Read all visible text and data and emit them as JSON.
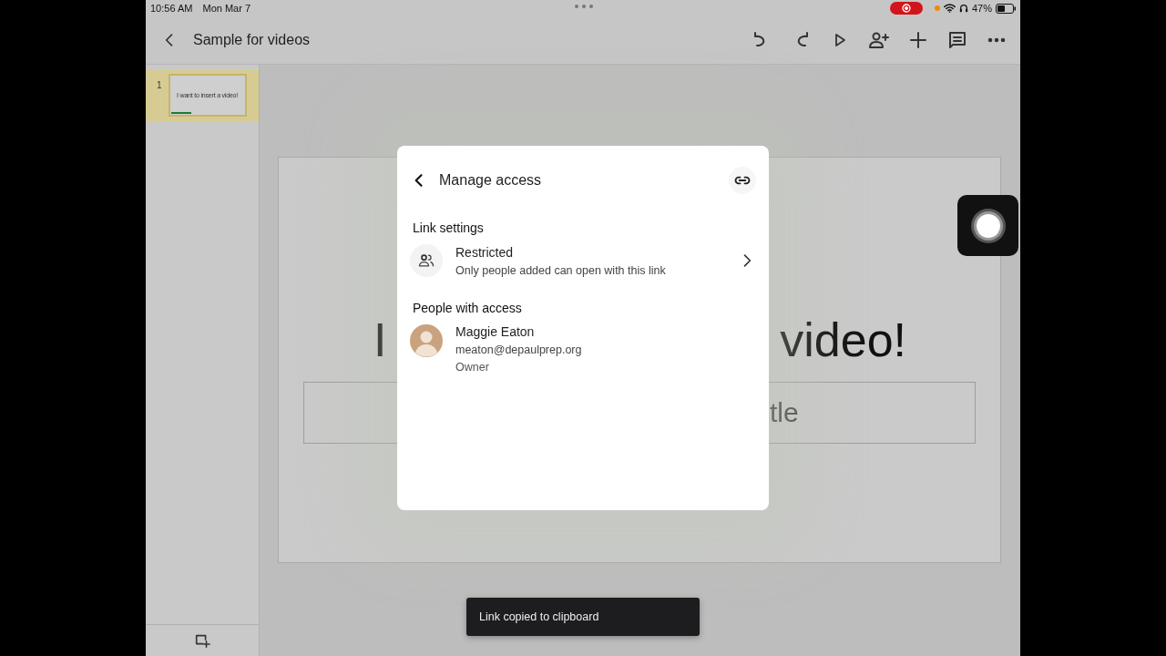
{
  "status_bar": {
    "time": "10:56 AM",
    "date": "Mon Mar 7",
    "battery": "47%"
  },
  "toolbar": {
    "title": "Sample for videos"
  },
  "slides": [
    {
      "number": "1",
      "text": "I want to insert a video!",
      "selected": true
    }
  ],
  "slide": {
    "title_parts": [
      "I",
      "video!"
    ],
    "subtitle_part": "tle"
  },
  "dialog": {
    "title": "Manage access",
    "link_settings": {
      "heading": "Link settings",
      "access": "Restricted",
      "description": "Only people added can open with this link"
    },
    "people": {
      "heading": "People with access",
      "members": [
        {
          "name": "Maggie Eaton",
          "email": "meaton@depaulprep.org",
          "role": "Owner"
        }
      ]
    }
  },
  "toast": "Link copied to clipboard"
}
